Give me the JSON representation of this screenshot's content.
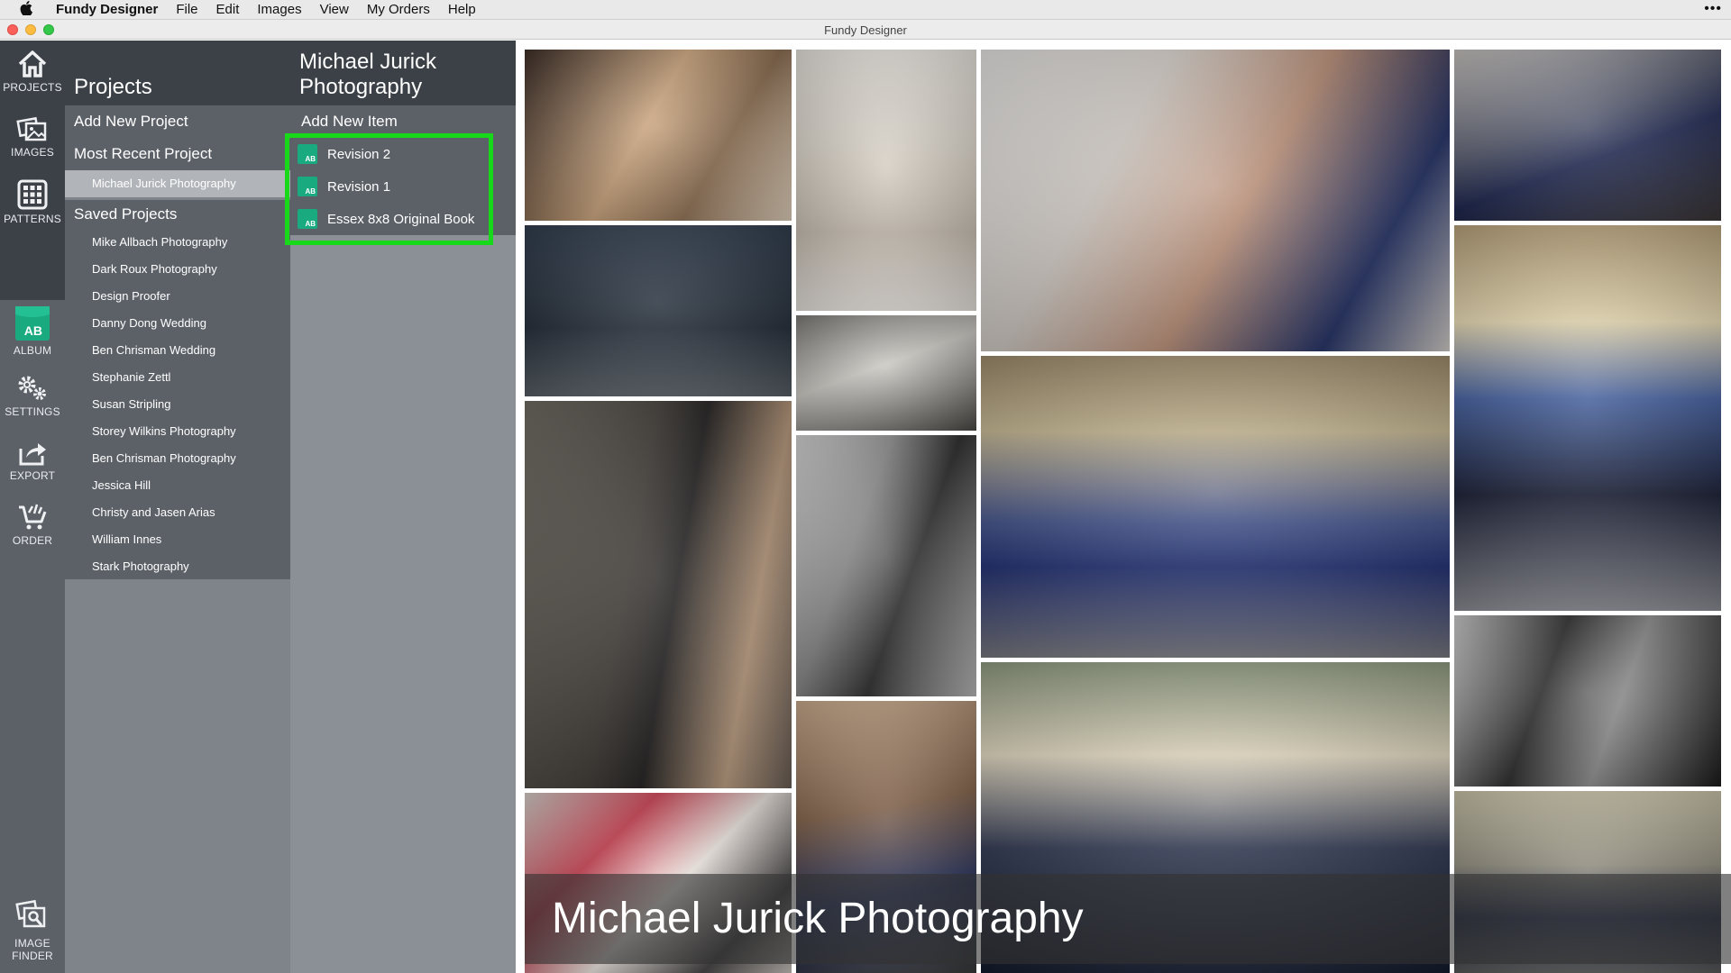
{
  "menubar": {
    "app_name": "Fundy Designer",
    "items": [
      "File",
      "Edit",
      "Images",
      "View",
      "My Orders",
      "Help"
    ]
  },
  "window": {
    "title": "Fundy Designer"
  },
  "rail": {
    "buttons": [
      {
        "label": "PROJECTS",
        "icon": "home-icon"
      },
      {
        "label": "IMAGES",
        "icon": "images-icon"
      },
      {
        "label": "PATTERNS",
        "icon": "grid-icon"
      },
      {
        "label": "ALBUM",
        "icon": "album-icon"
      },
      {
        "label": "SETTINGS",
        "icon": "gears-icon"
      },
      {
        "label": "EXPORT",
        "icon": "share-icon"
      },
      {
        "label": "ORDER",
        "icon": "cart-icon"
      },
      {
        "label_line1": "IMAGE",
        "label_line2": "FINDER",
        "icon": "image-finder-icon"
      }
    ]
  },
  "projects": {
    "title": "Projects",
    "add_new": "Add New Project",
    "most_recent_label": "Most Recent Project",
    "most_recent_item": "Michael Jurick Photography",
    "saved_label": "Saved Projects",
    "saved_items": [
      "Mike Allbach Photography",
      "Dark Roux Photography",
      "Design Proofer",
      "Danny Dong Wedding",
      "Ben Chrisman Wedding",
      "Stephanie Zettl",
      "Susan Stripling",
      "Storey Wilkins Photography",
      "Ben Chrisman Photography",
      "Jessica Hill",
      "Christy and Jasen Arias",
      "William Innes",
      "Stark Photography"
    ]
  },
  "items_panel": {
    "title": "Michael Jurick Photography",
    "add_new": "Add New Item",
    "items": [
      {
        "label": "Revision 2",
        "badge": "AB"
      },
      {
        "label": "Revision 1",
        "badge": "AB"
      },
      {
        "label": "Essex 8x8 Original Book",
        "badge": "AB"
      }
    ]
  },
  "collage": {
    "caption": "Michael Jurick Photography"
  },
  "colors": {
    "rail_dark": "#3c4147",
    "panel_mid": "#5c6168",
    "album_green": "#1aaa80",
    "highlight_green": "#18d81a"
  }
}
